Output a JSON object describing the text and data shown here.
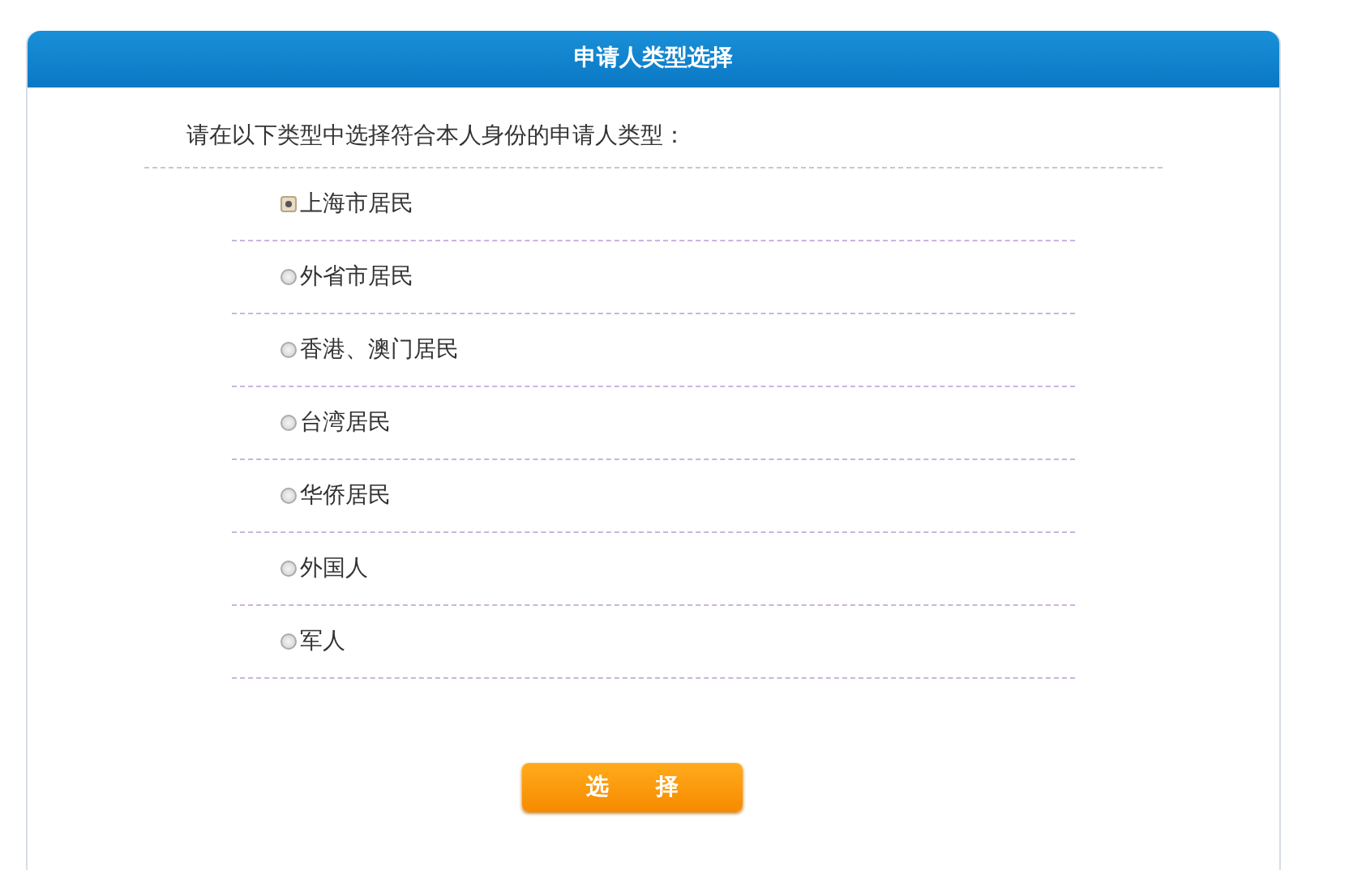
{
  "panel": {
    "title": "申请人类型选择",
    "prompt": "请在以下类型中选择符合本人身份的申请人类型：",
    "options": [
      {
        "label": "上海市居民",
        "selected": true
      },
      {
        "label": "外省市居民",
        "selected": false
      },
      {
        "label": "香港、澳门居民",
        "selected": false
      },
      {
        "label": "台湾居民",
        "selected": false
      },
      {
        "label": "华侨居民",
        "selected": false
      },
      {
        "label": "外国人",
        "selected": false
      },
      {
        "label": "军人",
        "selected": false
      }
    ],
    "button": "选 择"
  }
}
